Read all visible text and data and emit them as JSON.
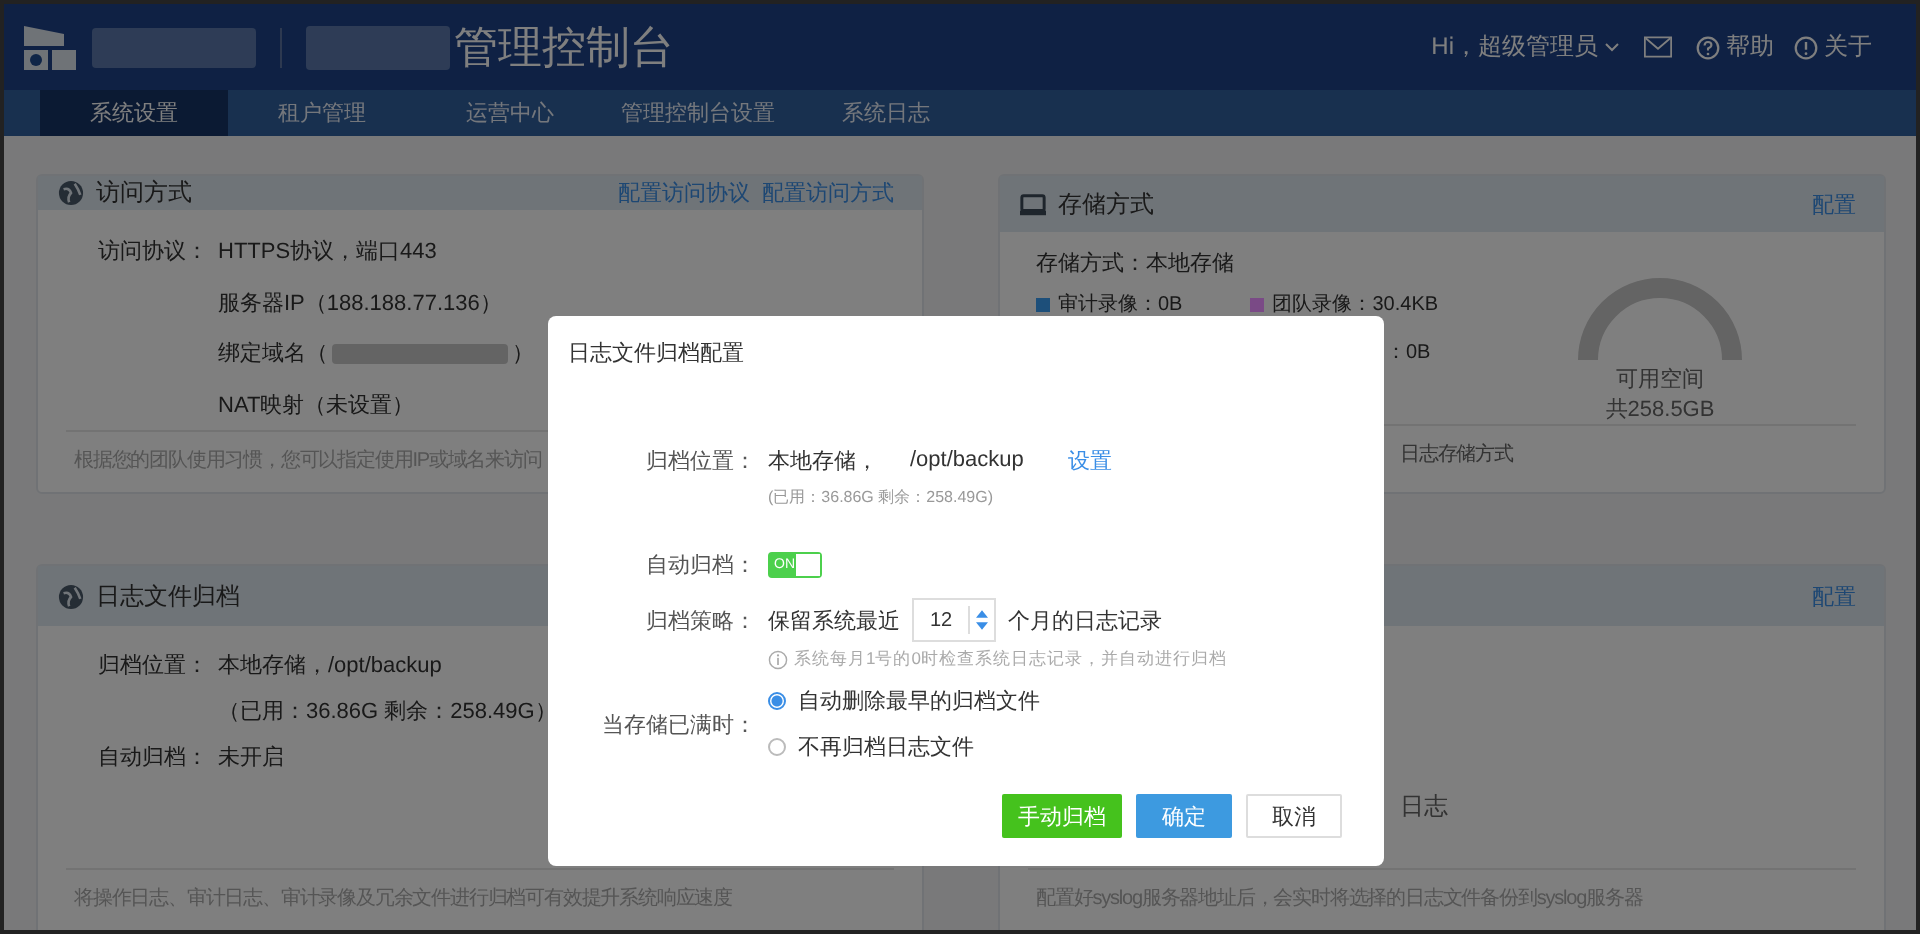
{
  "header": {
    "title": "管理控制台",
    "user": "Hi，超级管理员",
    "help": "帮助",
    "about": "关于"
  },
  "tabs": [
    {
      "label": "系统设置",
      "selected": true
    },
    {
      "label": "租户管理",
      "selected": false
    },
    {
      "label": "运营中心",
      "selected": false
    },
    {
      "label": "管理控制台设置",
      "selected": false
    },
    {
      "label": "系统日志",
      "selected": false
    }
  ],
  "access_panel": {
    "title": "访问方式",
    "links": [
      "配置访问协议",
      "配置访问方式"
    ],
    "rows": [
      {
        "label": "访问协议：",
        "value": "HTTPS协议，端口443"
      },
      {
        "value": "服务器IP（188.188.77.136）"
      },
      {
        "value": "绑定域名（",
        "redacted_suffix": "）"
      },
      {
        "value": "NAT映射（未设置）"
      }
    ],
    "footer": "根据您的团队使用习惯，您可以指定使用IP或域名来访问"
  },
  "storage_panel": {
    "title": "存储方式",
    "link": "配置",
    "mode": "存储方式：本地存储",
    "legend": [
      {
        "label": "审计录像：0B",
        "color": "#1d4f7a"
      },
      {
        "label": "团队录像：30.4KB",
        "color": "#7a4a86"
      }
    ],
    "legend_fragment": "：0B",
    "gauge_label": "可用空间",
    "gauge_total": "共258.5GB",
    "footer": "日志存储方式"
  },
  "archive_panel": {
    "title": "日志文件归档",
    "rows": [
      {
        "label": "归档位置：",
        "value": "本地存储，/opt/backup"
      },
      {
        "value": "（已用：36.86G 剩余：258.49G）"
      },
      {
        "label": "自动归档：",
        "value": "未开启"
      }
    ],
    "footer": "将操作日志、审计日志、审计录像及冗余文件进行归档可有效提升系统响应速度"
  },
  "syslog_panel": {
    "link": "配置",
    "body_fragment": "日志",
    "footer": "配置好syslog服务器地址后，会实时将选择的日志文件备份到syslog服务器"
  },
  "dialog": {
    "title": "日志文件归档配置",
    "location_label": "归档位置：",
    "location": "本地存储，",
    "path": "/opt/backup",
    "set_link": "设置",
    "usage": "(已用：36.86G 剩余：258.49G)",
    "auto_label": "自动归档：",
    "auto_on": true,
    "switch_text": "ON",
    "policy_label": "归档策略：",
    "policy_prefix": "保留系统最近",
    "months": "12",
    "policy_suffix": "个月的日志记录",
    "hint": "系统每月1号的0时检查系统日志记录，并自动进行归档",
    "full_label": "当存储已满时：",
    "options": [
      {
        "label": "自动删除最早的归档文件",
        "selected": true
      },
      {
        "label": "不再归档日志文件",
        "selected": false
      }
    ],
    "buttons": [
      {
        "label": "手动归档",
        "kind": "success"
      },
      {
        "label": "确定",
        "kind": "primary"
      },
      {
        "label": "取消",
        "kind": "default"
      }
    ]
  }
}
